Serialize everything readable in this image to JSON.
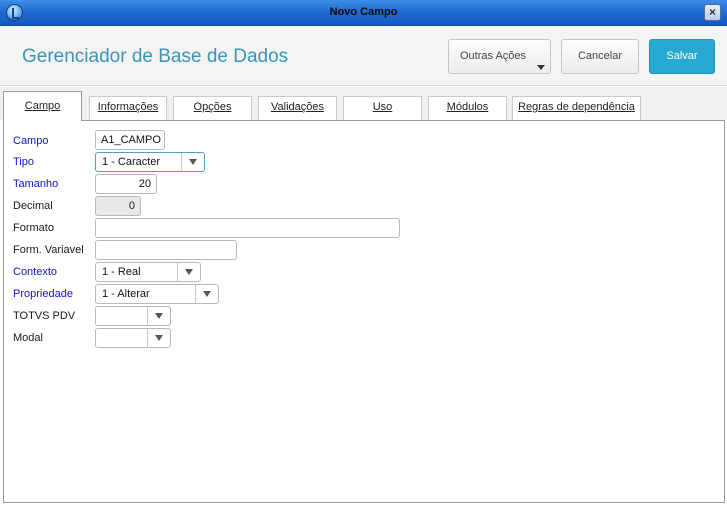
{
  "window": {
    "title": "Novo Campo",
    "close_glyph": "×"
  },
  "header": {
    "title": "Gerenciador de Base de Dados",
    "outras_acoes": "Outras Ações",
    "cancelar": "Cancelar",
    "salvar": "Salvar"
  },
  "tabs": [
    {
      "label": "Campo",
      "active": true
    },
    {
      "label": "Informações"
    },
    {
      "label": "Opções"
    },
    {
      "label": "Validações"
    },
    {
      "label": "Uso"
    },
    {
      "label": "Módulos"
    },
    {
      "label": "Regras de dependência"
    }
  ],
  "form": {
    "campo": {
      "label": "Campo",
      "value": "A1_CAMPO",
      "required": true
    },
    "tipo": {
      "label": "Tipo",
      "value": "1 - Caracter",
      "required": true
    },
    "tamanho": {
      "label": "Tamanho",
      "value": "20",
      "required": true
    },
    "decimal": {
      "label": "Decimal",
      "value": "0",
      "required": false
    },
    "formato": {
      "label": "Formato",
      "value": "",
      "required": false
    },
    "form_variavel": {
      "label": "Form. Variavel",
      "value": "",
      "required": false
    },
    "contexto": {
      "label": "Contexto",
      "value": "1 - Real",
      "required": true
    },
    "propriedade": {
      "label": "Propriedade",
      "value": "1 - Alterar",
      "required": true
    },
    "totvs_pdv": {
      "label": "TOTVS PDV",
      "value": "",
      "required": false
    },
    "modal": {
      "label": "Modal",
      "value": "",
      "required": false
    }
  },
  "colors": {
    "accent": "#3a95b6",
    "primary_button": "#28a9d1",
    "required_label": "#1313c0",
    "titlebar": "#1c66cf"
  }
}
